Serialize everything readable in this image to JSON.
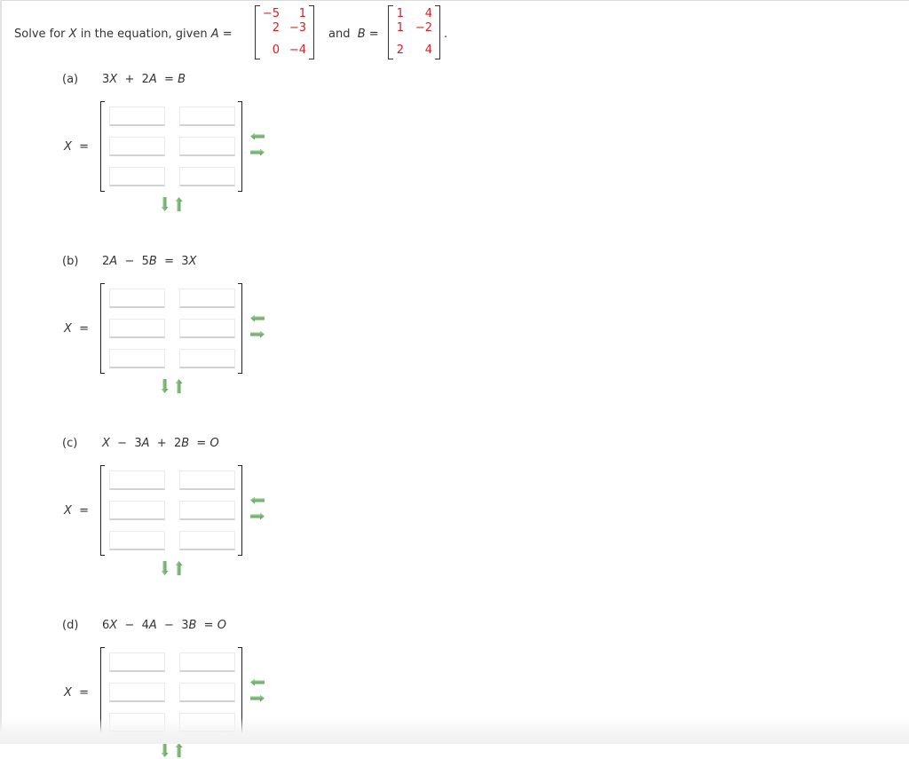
{
  "question": {
    "prefix": "Solve for ",
    "var_x": "X",
    "middle": " in the equation, given ",
    "var_a": "A",
    "equals": " =",
    "and_text": "and",
    "var_b": "B",
    "equals_b": " =",
    "period": "."
  },
  "matrix_A": {
    "rows": [
      [
        "−5",
        "1"
      ],
      [
        "2",
        "−3"
      ],
      [
        "0",
        "−4"
      ]
    ],
    "color": "#d22222"
  },
  "matrix_B": {
    "rows": [
      [
        "1",
        "4"
      ],
      [
        "1",
        "−2"
      ],
      [
        "2",
        "4"
      ]
    ],
    "color": "#d22222"
  },
  "parts": [
    {
      "label": "(a)",
      "equation": "3X + 2A = B",
      "x_label": "X =",
      "answers": [
        [
          "",
          ""
        ],
        [
          "",
          ""
        ],
        [
          "",
          ""
        ]
      ]
    },
    {
      "label": "(b)",
      "equation": "2A − 5B = 3X",
      "x_label": "X =",
      "answers": [
        [
          "",
          ""
        ],
        [
          "",
          ""
        ],
        [
          "",
          ""
        ]
      ]
    },
    {
      "label": "(c)",
      "equation": "X − 3A + 2B = O",
      "x_label": "X =",
      "answers": [
        [
          "",
          ""
        ],
        [
          "",
          ""
        ],
        [
          "",
          ""
        ]
      ]
    },
    {
      "label": "(d)",
      "equation": "6X − 4A − 3B = O",
      "x_label": "X =",
      "answers": [
        [
          "",
          ""
        ],
        [
          "",
          ""
        ],
        [
          "",
          ""
        ]
      ]
    }
  ],
  "icons": {
    "remove_column": "arrow-left-icon",
    "add_column": "arrow-right-icon",
    "add_row": "arrow-down-icon",
    "remove_row": "arrow-up-icon"
  },
  "colors": {
    "matrix_entry": "#d22222",
    "arrow_green": "#6aa86a"
  }
}
